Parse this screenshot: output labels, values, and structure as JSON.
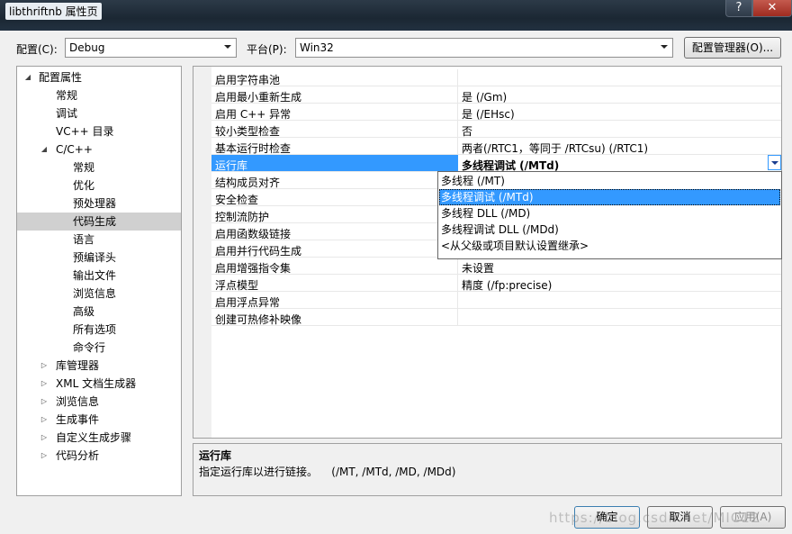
{
  "window": {
    "title": "libthriftnb 属性页",
    "help_label": "?",
    "close_label": "✕"
  },
  "config_bar": {
    "config_label": "配置(C):",
    "config_value": "Debug",
    "platform_label": "平台(P):",
    "platform_value": "Win32",
    "manager_label": "配置管理器(O)..."
  },
  "tree": [
    {
      "label": "配置属性",
      "expander": "◢",
      "level": 0
    },
    {
      "label": "常规",
      "expander": "",
      "level": 1
    },
    {
      "label": "调试",
      "expander": "",
      "level": 1
    },
    {
      "label": "VC++ 目录",
      "expander": "",
      "level": 1
    },
    {
      "label": "C/C++",
      "expander": "◢",
      "level": 1
    },
    {
      "label": "常规",
      "expander": "",
      "level": 2
    },
    {
      "label": "优化",
      "expander": "",
      "level": 2
    },
    {
      "label": "预处理器",
      "expander": "",
      "level": 2
    },
    {
      "label": "代码生成",
      "expander": "",
      "level": 2,
      "selected": true
    },
    {
      "label": "语言",
      "expander": "",
      "level": 2
    },
    {
      "label": "预编译头",
      "expander": "",
      "level": 2
    },
    {
      "label": "输出文件",
      "expander": "",
      "level": 2
    },
    {
      "label": "浏览信息",
      "expander": "",
      "level": 2
    },
    {
      "label": "高级",
      "expander": "",
      "level": 2
    },
    {
      "label": "所有选项",
      "expander": "",
      "level": 2
    },
    {
      "label": "命令行",
      "expander": "",
      "level": 2
    },
    {
      "label": "库管理器",
      "expander": "▷",
      "level": 1
    },
    {
      "label": "XML 文档生成器",
      "expander": "▷",
      "level": 1
    },
    {
      "label": "浏览信息",
      "expander": "▷",
      "level": 1
    },
    {
      "label": "生成事件",
      "expander": "▷",
      "level": 1
    },
    {
      "label": "自定义生成步骤",
      "expander": "▷",
      "level": 1
    },
    {
      "label": "代码分析",
      "expander": "▷",
      "level": 1
    }
  ],
  "properties": [
    {
      "name": "启用字符串池",
      "value": ""
    },
    {
      "name": "启用最小重新生成",
      "value": "是 (/Gm)"
    },
    {
      "name": "启用 C++ 异常",
      "value": "是 (/EHsc)"
    },
    {
      "name": "较小类型检查",
      "value": "否"
    },
    {
      "name": "基本运行时检查",
      "value": "两者(/RTC1，等同于 /RTCsu) (/RTC1)"
    },
    {
      "name": "运行库",
      "value": "多线程调试 (/MTd)",
      "selected": true
    },
    {
      "name": "结构成员对齐",
      "value": ""
    },
    {
      "name": "安全检查",
      "value": ""
    },
    {
      "name": "控制流防护",
      "value": ""
    },
    {
      "name": "启用函数级链接",
      "value": ""
    },
    {
      "name": "启用并行代码生成",
      "value": ""
    },
    {
      "name": "启用增强指令集",
      "value": "未设置"
    },
    {
      "name": "浮点模型",
      "value": "精度 (/fp:precise)"
    },
    {
      "name": "启用浮点异常",
      "value": ""
    },
    {
      "name": "创建可热修补映像",
      "value": ""
    }
  ],
  "dropdown": {
    "options": [
      {
        "label": "多线程 (/MT)"
      },
      {
        "label": "多线程调试 (/MTd)",
        "highlighted": true
      },
      {
        "label": "多线程 DLL (/MD)"
      },
      {
        "label": "多线程调试 DLL (/MDd)"
      },
      {
        "label": "<从父级或项目默认设置继承>"
      }
    ]
  },
  "description": {
    "title": "运行库",
    "text": "指定运行库以进行链接。    (/MT, /MTd, /MD, /MDd)"
  },
  "buttons": {
    "ok": "确定",
    "cancel": "取消",
    "apply": "应用(A)"
  },
  "watermark": "https://blog.csdn.net/MIC12",
  "colors": {
    "selection": "#3399ff",
    "tree_selection": "#d0d0d0",
    "titlebar": "#1b2733"
  }
}
